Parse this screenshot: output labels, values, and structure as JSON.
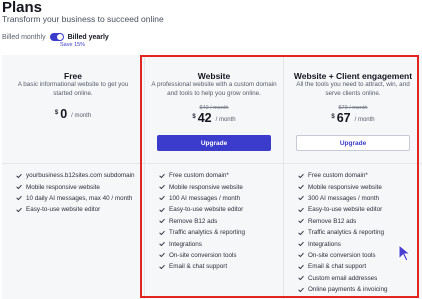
{
  "header": {
    "title": "Plans",
    "subtitle": "Transform your business to succeed online"
  },
  "billing": {
    "monthly_label": "Billed monthly",
    "yearly_label": "Billed yearly",
    "save_note": "Save 15%",
    "toggle_state": "yearly",
    "accent_color": "#3b3ccb"
  },
  "plans": [
    {
      "name": "Free",
      "description": "A basic informational website to get you started online.",
      "old_price": "",
      "currency": "$",
      "price": "0",
      "period": "/ month",
      "button": "",
      "features": [
        "yourbusiness.b12sites.com subdomain",
        "Mobile responsive website",
        "10 daily AI messages, max 40 / month",
        "Easy-to-use website editor"
      ]
    },
    {
      "name": "Website",
      "description": "A professional website with a custom domain and tools to help you grow online.",
      "old_price": "$49 / month",
      "currency": "$",
      "price": "42",
      "period": "/ month",
      "button": "Upgrade",
      "features": [
        "Free custom domain*",
        "Mobile responsive website",
        "100 AI messages / month",
        "Easy-to-use website editor",
        "Remove B12 ads",
        "Traffic analytics & reporting",
        "Integrations",
        "On-site conversion tools",
        "Email & chat support"
      ]
    },
    {
      "name": "Website + Client engagement",
      "description": "All the tools you need to attract, win, and serve clients online.",
      "old_price": "$79 / month",
      "currency": "$",
      "price": "67",
      "period": "/ month",
      "button": "Upgrade",
      "features": [
        "Free custom domain*",
        "Mobile responsive website",
        "300 AI messages / month",
        "Easy-to-use website editor",
        "Remove B12 ads",
        "Traffic analytics & reporting",
        "Integrations",
        "On-site conversion tools",
        "Email & chat support",
        "Custom email addresses",
        "Online payments & invoicing"
      ]
    }
  ],
  "colors": {
    "highlight_border": "#e3251f",
    "check": "#2a2e38",
    "primary_button": "#3b3ccb"
  }
}
